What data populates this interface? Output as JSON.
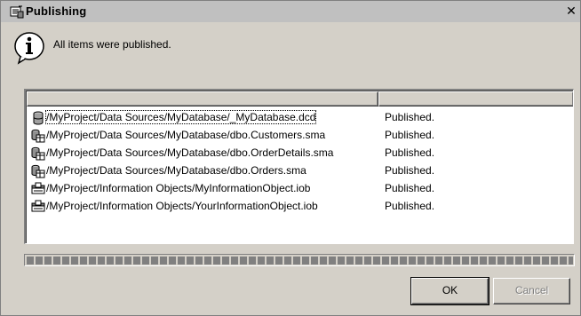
{
  "window": {
    "title": "Publishing",
    "close_glyph": "✕"
  },
  "message": "All items were published.",
  "list": {
    "columns": [
      "",
      ""
    ],
    "rows": [
      {
        "icon": "database-icon",
        "path": "/MyProject/Data Sources/MyDatabase/_MyDatabase.dcd",
        "status": "Published."
      },
      {
        "icon": "schema-table-icon",
        "path": "/MyProject/Data Sources/MyDatabase/dbo.Customers.sma",
        "status": "Published."
      },
      {
        "icon": "schema-table-icon",
        "path": "/MyProject/Data Sources/MyDatabase/dbo.OrderDetails.sma",
        "status": "Published."
      },
      {
        "icon": "schema-table-icon",
        "path": "/MyProject/Data Sources/MyDatabase/dbo.Orders.sma",
        "status": "Published."
      },
      {
        "icon": "information-object-icon",
        "path": "/MyProject/Information Objects/MyInformationObject.iob",
        "status": "Published."
      },
      {
        "icon": "information-object-icon",
        "path": "/MyProject/Information Objects/YourInformationObject.iob",
        "status": "Published."
      }
    ]
  },
  "progress": {
    "value": 1.0
  },
  "buttons": {
    "ok": "OK",
    "cancel": "Cancel"
  },
  "colors": {
    "dialog_bg": "#d4d0c8",
    "title_bg": "#c0c0c0",
    "list_bg": "#ffffff",
    "progress_fill": "#808080"
  }
}
